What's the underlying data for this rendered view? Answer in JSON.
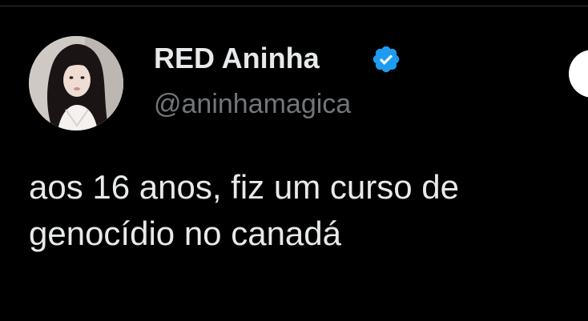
{
  "tweet": {
    "display_name": "RED Aninha",
    "handle": "@aninhamagica",
    "verified_icon": "verified-badge-icon",
    "text_lines": [
      "aos 16 anos, fiz um curso de",
      "genocídio no canadá"
    ]
  },
  "colors": {
    "background": "#000000",
    "primary_text": "#e7e9ea",
    "secondary_text": "#71767b",
    "verified_blue": "#1d9bf0"
  }
}
